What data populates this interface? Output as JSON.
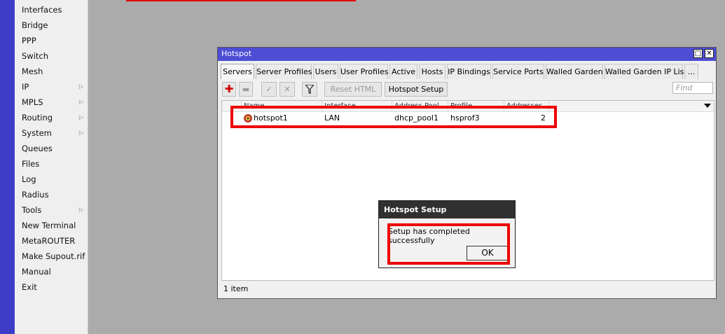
{
  "sidebar": {
    "items": [
      {
        "label": "Interfaces",
        "submenu": false
      },
      {
        "label": "Bridge",
        "submenu": false
      },
      {
        "label": "PPP",
        "submenu": false
      },
      {
        "label": "Switch",
        "submenu": false
      },
      {
        "label": "Mesh",
        "submenu": false
      },
      {
        "label": "IP",
        "submenu": true
      },
      {
        "label": "MPLS",
        "submenu": true
      },
      {
        "label": "Routing",
        "submenu": true
      },
      {
        "label": "System",
        "submenu": true
      },
      {
        "label": "Queues",
        "submenu": false
      },
      {
        "label": "Files",
        "submenu": false
      },
      {
        "label": "Log",
        "submenu": false
      },
      {
        "label": "Radius",
        "submenu": false
      },
      {
        "label": "Tools",
        "submenu": true
      },
      {
        "label": "New Terminal",
        "submenu": false
      },
      {
        "label": "MetaROUTER",
        "submenu": false
      },
      {
        "label": "Make Supout.rif",
        "submenu": false
      },
      {
        "label": "Manual",
        "submenu": false
      },
      {
        "label": "Exit",
        "submenu": false
      }
    ]
  },
  "window": {
    "title": "Hotspot",
    "tabs": [
      "Servers",
      "Server Profiles",
      "Users",
      "User Profiles",
      "Active",
      "Hosts",
      "IP Bindings",
      "Service Ports",
      "Walled Garden",
      "Walled Garden IP List",
      "..."
    ],
    "active_tab": "Servers",
    "toolbar": {
      "reset_html": "Reset HTML",
      "hotspot_setup": "Hotspot Setup",
      "find_placeholder": "Find"
    },
    "columns": [
      "Name",
      "Interface",
      "Address Pool",
      "Profile",
      "Addresses"
    ],
    "rows": [
      {
        "name": "hotspot1",
        "interface": "LAN",
        "address_pool": "dhcp_pool1",
        "profile": "hsprof3",
        "addresses": "2"
      }
    ],
    "status": "1 item"
  },
  "dialog": {
    "title": "Hotspot Setup",
    "message": "Setup has completed successfully",
    "ok": "OK"
  },
  "colors": {
    "titlebar": "#4d4dd5",
    "highlight": "#ee0000",
    "dialog_title": "#303030"
  }
}
